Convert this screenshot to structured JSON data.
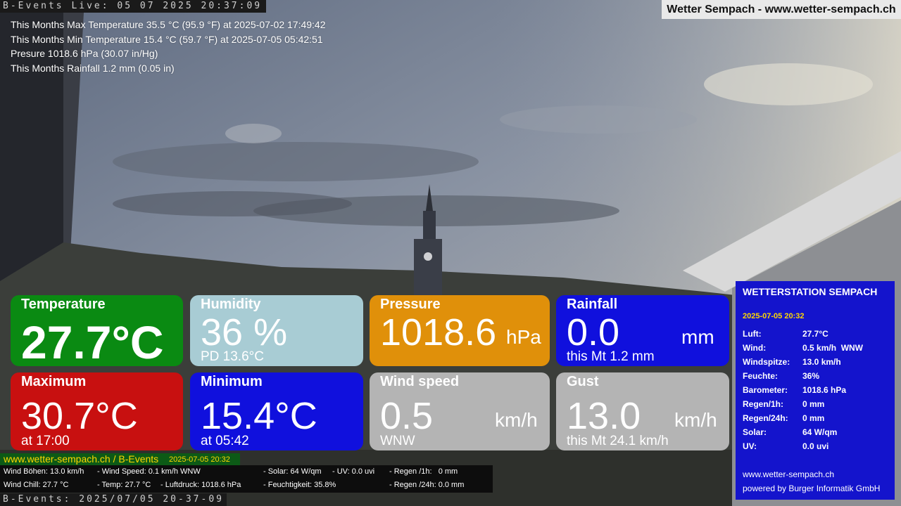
{
  "osd": {
    "top": "B-Events Live: 05 07 2025 20:37:09",
    "bottom": "B-Events: 2025/07/05 20-37-09"
  },
  "banner": "Wetter Sempach - www.wetter-sempach.ch",
  "stats": [
    "This Months Max Temperature 35.5 °C (95.9 °F) at 2025-07-02 17:49:42",
    "This Months Min Temperature 15.4 °C (59.7 °F) at 2025-07-05 05:42:51",
    "Presure 1018.6 hPa (30.07 in/Hg)",
    "This Months Rainfall 1.2 mm (0.05 in)"
  ],
  "tiles": {
    "temperature": {
      "title": "Temperature",
      "value": "27.7°C",
      "color": "#0a8a12"
    },
    "humidity": {
      "title": "Humidity",
      "value": "36 %",
      "sub": "PD 13.6°C",
      "color": "#a8ccd4"
    },
    "pressure": {
      "title": "Pressure",
      "value": "1018.6",
      "unit": "hPa",
      "color": "#e0900a"
    },
    "rainfall": {
      "title": "Rainfall",
      "value": "0.0",
      "unit": "mm",
      "sub": "this Mt 1.2 mm",
      "color": "#1010dd"
    },
    "maximum": {
      "title": "Maximum",
      "value": "30.7°C",
      "sub": "at 17:00",
      "color": "#c81010"
    },
    "minimum": {
      "title": "Minimum",
      "value": "15.4°C",
      "sub": "at 05:42",
      "color": "#1010dd"
    },
    "windspeed": {
      "title": "Wind speed",
      "value": "0.5",
      "unit": "km/h",
      "sub": "WNW",
      "color": "#b4b4b4"
    },
    "gust": {
      "title": "Gust",
      "value": "13.0",
      "unit": "km/h",
      "sub": "this Mt 24.1 km/h",
      "color": "#b4b4b4"
    }
  },
  "sidebar": {
    "title": "WETTERSTATION SEMPACH",
    "date": "2025-07-05 20:32",
    "rows": [
      {
        "k": "Luft:",
        "v": "27.7°C"
      },
      {
        "k": "Wind:",
        "v": "0.5 km/h  WNW"
      },
      {
        "k": "Windspitze:",
        "v": "13.0 km/h"
      },
      {
        "k": "Feuchte:",
        "v": "36%"
      },
      {
        "k": "Barometer:",
        "v": "1018.6 hPa"
      },
      {
        "k": "Regen/1h:",
        "v": "0 mm"
      },
      {
        "k": "Regen/24h:",
        "v": "0 mm"
      },
      {
        "k": "Solar:",
        "v": "64 W/qm"
      },
      {
        "k": "UV:",
        "v": "0.0 uvi"
      }
    ],
    "web": "www.wetter-sempach.ch",
    "powered": "powered by Burger Informatik GmbH"
  },
  "ticker": {
    "site": "www.wetter-sempach.ch / B-Events",
    "datetime": "2025-07-05 20:32",
    "line1": [
      "Wind Böhen: 13.0 km/h",
      "- Wind Speed: 0.1 km/h WNW",
      "- Solar: 64 W/qm",
      "- UV: 0.0 uvi",
      "- Regen /1h:   0 mm"
    ],
    "line2": [
      "Wind Chill: 27.7 °C",
      "- Temp: 27.7 °C",
      "- Luftdruck: 1018.6 hPa",
      "- Feuchtigkeit: 35.8%",
      "- Regen /24h: 0.0 mm"
    ]
  }
}
